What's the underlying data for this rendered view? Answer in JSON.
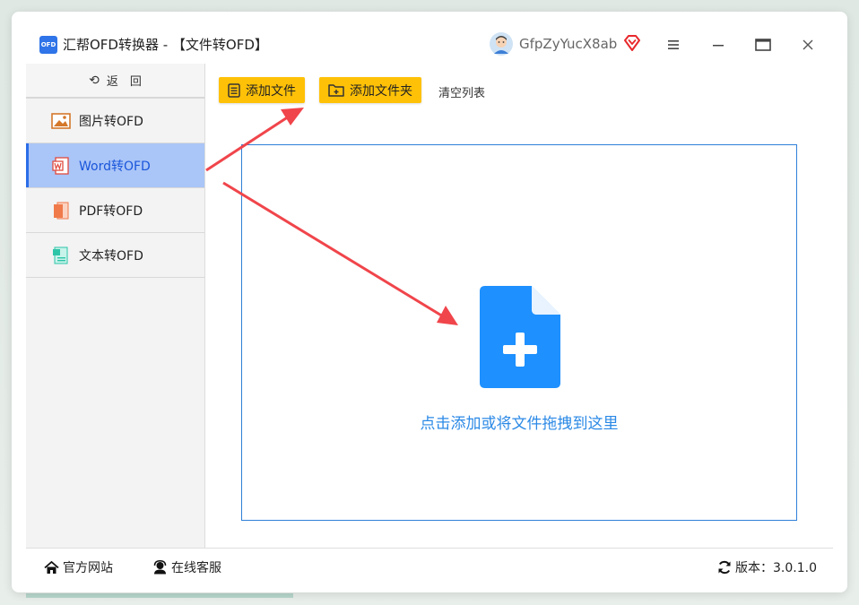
{
  "window": {
    "logo_text": "OFD",
    "title": "汇帮OFD转换器 - 【文件转OFD】",
    "username": "GfpZyYucX8ab",
    "controls": [
      "menu-icon",
      "minimize-icon",
      "maximize-icon",
      "close-icon"
    ]
  },
  "sidebar": {
    "back_label": "返　回",
    "items": [
      {
        "label": "图片转OFD",
        "icon": "image-icon",
        "active": false
      },
      {
        "label": "Word转OFD",
        "icon": "word-icon",
        "active": true
      },
      {
        "label": "PDF转OFD",
        "icon": "pdf-icon",
        "active": false
      },
      {
        "label": "文本转OFD",
        "icon": "text-file-icon",
        "active": false
      }
    ]
  },
  "toolbar": {
    "add_file_label": "添加文件",
    "add_folder_label": "添加文件夹",
    "clear_label": "清空列表"
  },
  "dropzone": {
    "text": "点击添加或将文件拖拽到这里",
    "icon": "add-file-icon"
  },
  "statusbar": {
    "website_label": "官方网站",
    "service_label": "在线客服",
    "version_label": "版本：3.0.1.0"
  },
  "colors": {
    "accent_yellow": "#ffc107",
    "active_item_bg": "#aac5f7",
    "active_item_text": "#1a56db",
    "drop_icon_blue": "#1e90ff",
    "drop_text_blue": "#2b89e6",
    "annotation_arrow": "#f0454b"
  }
}
